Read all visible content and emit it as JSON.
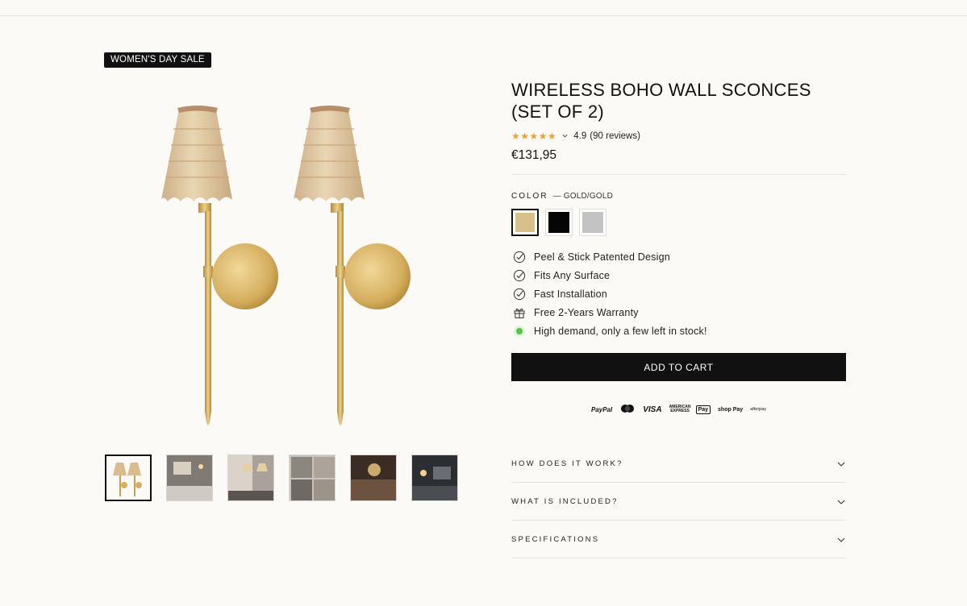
{
  "badge": "WOMEN'S DAY SALE",
  "product": {
    "title": "WIRELESS BOHO WALL SCONCES (SET OF 2)",
    "stars": "★★★★★",
    "rating": "4.9",
    "reviews": "(90 reviews)",
    "price": "€131,95"
  },
  "color": {
    "label": "COLOR",
    "selected": "— GOLD/GOLD",
    "swatches": [
      {
        "name": "Gold/Gold",
        "hex": "#d8c189"
      },
      {
        "name": "Black",
        "hex": "#050505"
      },
      {
        "name": "Silver",
        "hex": "#c3c3c3"
      }
    ]
  },
  "features": [
    {
      "icon": "check-circle-icon",
      "text": "Peel & Stick Patented Design"
    },
    {
      "icon": "check-circle-icon",
      "text": "Fits Any Surface"
    },
    {
      "icon": "check-circle-icon",
      "text": "Fast Installation"
    },
    {
      "icon": "gift-icon",
      "text": "Free 2-Years Warranty"
    },
    {
      "icon": "green-dot-icon",
      "text": "High demand, only a few left in stock!"
    }
  ],
  "cart": {
    "label": "ADD TO CART"
  },
  "payments": {
    "paypal": "PayPal",
    "mastercard": "●●",
    "visa": "VISA",
    "amex": "AMERICAN EXPRESS",
    "applepay": "Pay",
    "shoppay": "shop Pay",
    "afterpay": "afterpay"
  },
  "accordion": [
    {
      "label": "HOW DOES IT WORK?"
    },
    {
      "label": "WHAT IS INCLUDED?"
    },
    {
      "label": "SPECIFICATIONS"
    }
  ],
  "colors": {
    "accent": "#111111",
    "background": "#fbfaf7",
    "star": "#e8a33b",
    "stock_dot": "#5cc04a"
  }
}
